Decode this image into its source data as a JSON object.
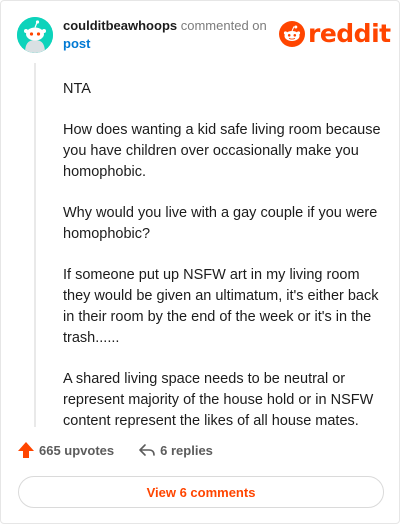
{
  "comment": {
    "username": "coulditbeawhoops",
    "action_text": "commented on",
    "target_link": "post",
    "paragraphs": [
      "NTA",
      "How does wanting a kid safe living room because you have children over occasionally make you homophobic.",
      "Why would you live with a gay couple if you were homophobic?",
      "If someone put up NSFW art in my living room they would be given an ultimatum, it's either back in their room by the end of the week or it's in the trash......",
      "A shared living space needs to be neutral or represent majority of the house hold or in NSFW content represent the likes of all house mates."
    ]
  },
  "brand": {
    "name": "reddit",
    "color": "#ff4500"
  },
  "avatar": {
    "icon": "snoo-avatar-icon",
    "color": "#0dd3bb"
  },
  "actions": {
    "upvotes_label": "665 upvotes",
    "replies_label": "6 replies"
  },
  "footer": {
    "view_comments_label": "View 6 comments"
  }
}
